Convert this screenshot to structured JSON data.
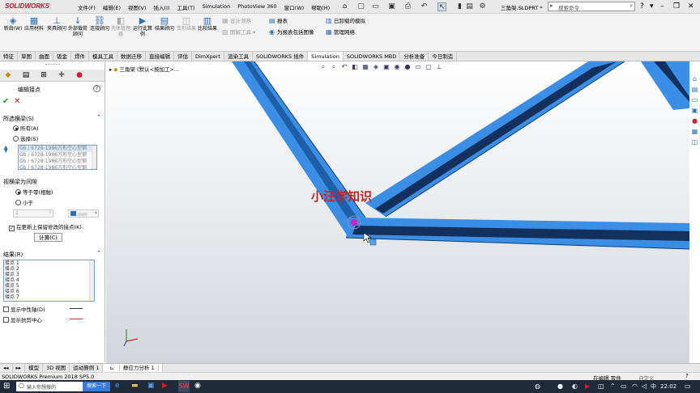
{
  "app": {
    "logo": "SOLIDWORKS",
    "document_title": "三角架.SLDPRT *"
  },
  "menu": [
    "文件(F)",
    "编辑(E)",
    "视图(V)",
    "插入(I)",
    "工具(T)",
    "Simulation",
    "PhotoView 360",
    "窗口(W)",
    "帮助(H)"
  ],
  "search": {
    "placeholder": "搜索命令"
  },
  "ribbon": {
    "buttons": [
      {
        "label": "新肩(W)",
        "dim": false
      },
      {
        "label": "应用材料",
        "dim": false
      },
      {
        "label": "夹具顾问",
        "dim": false
      },
      {
        "label": "外部载荷顾问",
        "dim": false
      },
      {
        "label": "连接顾问",
        "dim": false
      },
      {
        "label": "壳体管理器",
        "dim": true
      },
      {
        "label": "运行此算例",
        "dim": false
      },
      {
        "label": "结果顾问",
        "dim": false
      },
      {
        "label": "变形结果",
        "dim": true
      },
      {
        "label": "比较结果",
        "dim": false
      }
    ],
    "small": [
      {
        "label": "设计洞察",
        "dim": true
      },
      {
        "label": "图解工具",
        "dim": true
      },
      {
        "label": "报表",
        "dim": false
      },
      {
        "label": "为报表包括图像",
        "dim": false
      },
      {
        "label": "已卸载的模拟",
        "dim": false
      },
      {
        "label": "管理网络",
        "dim": false
      }
    ]
  },
  "tabs": [
    "特征",
    "草图",
    "曲面",
    "钣金",
    "焊件",
    "模具工具",
    "数据迁移",
    "直接编辑",
    "评估",
    "DimXpert",
    "渲染工具",
    "SOLIDWORKS 插件",
    "Simulation",
    "SOLIDWORKS MBD",
    "分析准备",
    "今日制造"
  ],
  "active_tab": "Simulation",
  "tree": {
    "label": "三角架 (默认<按加工>...",
    "arrow": "▸"
  },
  "pm": {
    "title": "编辑接点",
    "help": "?",
    "selected_beams": {
      "heading": "所选横梁(S)",
      "options": [
        "所有(A)",
        "选择(S)"
      ],
      "items": [
        "Gb / 6728-1986方形空心型钢",
        "Gb / 6728-1986方形空心型钢",
        "Gb / 6728-1986方形空心型钢",
        "Gb / 6728-1986方形空心型钢"
      ]
    },
    "clearance": {
      "heading": "视横梁为间隙",
      "options": [
        "等于零(相触)",
        "小于"
      ],
      "value": "1",
      "unit": "mm"
    },
    "keep_modified": "在更新上保留修改的接点(K)",
    "calc_button": "计算(C)",
    "results": {
      "heading": "结果(R)",
      "items": [
        "接点 1",
        "接点 2",
        "接点 3",
        "接点 4",
        "接点 5",
        "接点 6",
        "接点 7"
      ]
    },
    "show_neutral": "显示中性轴(D)",
    "show_shear": "显示抗剪中心"
  },
  "watermark": "小汪学知识",
  "bottom_tabs": [
    "模型",
    "3D 视图",
    "运动算例 1",
    "静应力分析 1"
  ],
  "active_bottom_tab": "静应力分析 1",
  "status": {
    "left": "SOLIDWORKS Premium 2018 SP5.0",
    "mode": "在编辑 零件",
    "custom": "自定义"
  },
  "taskbar": {
    "search_placeholder": "输入你想搜的",
    "search_button": "搜索一下",
    "ime": "中",
    "time": "22:02"
  },
  "colors": {
    "beam": "#3a8ee6",
    "beam_dark": "#1e5fa8",
    "accent": "#c8102e"
  }
}
